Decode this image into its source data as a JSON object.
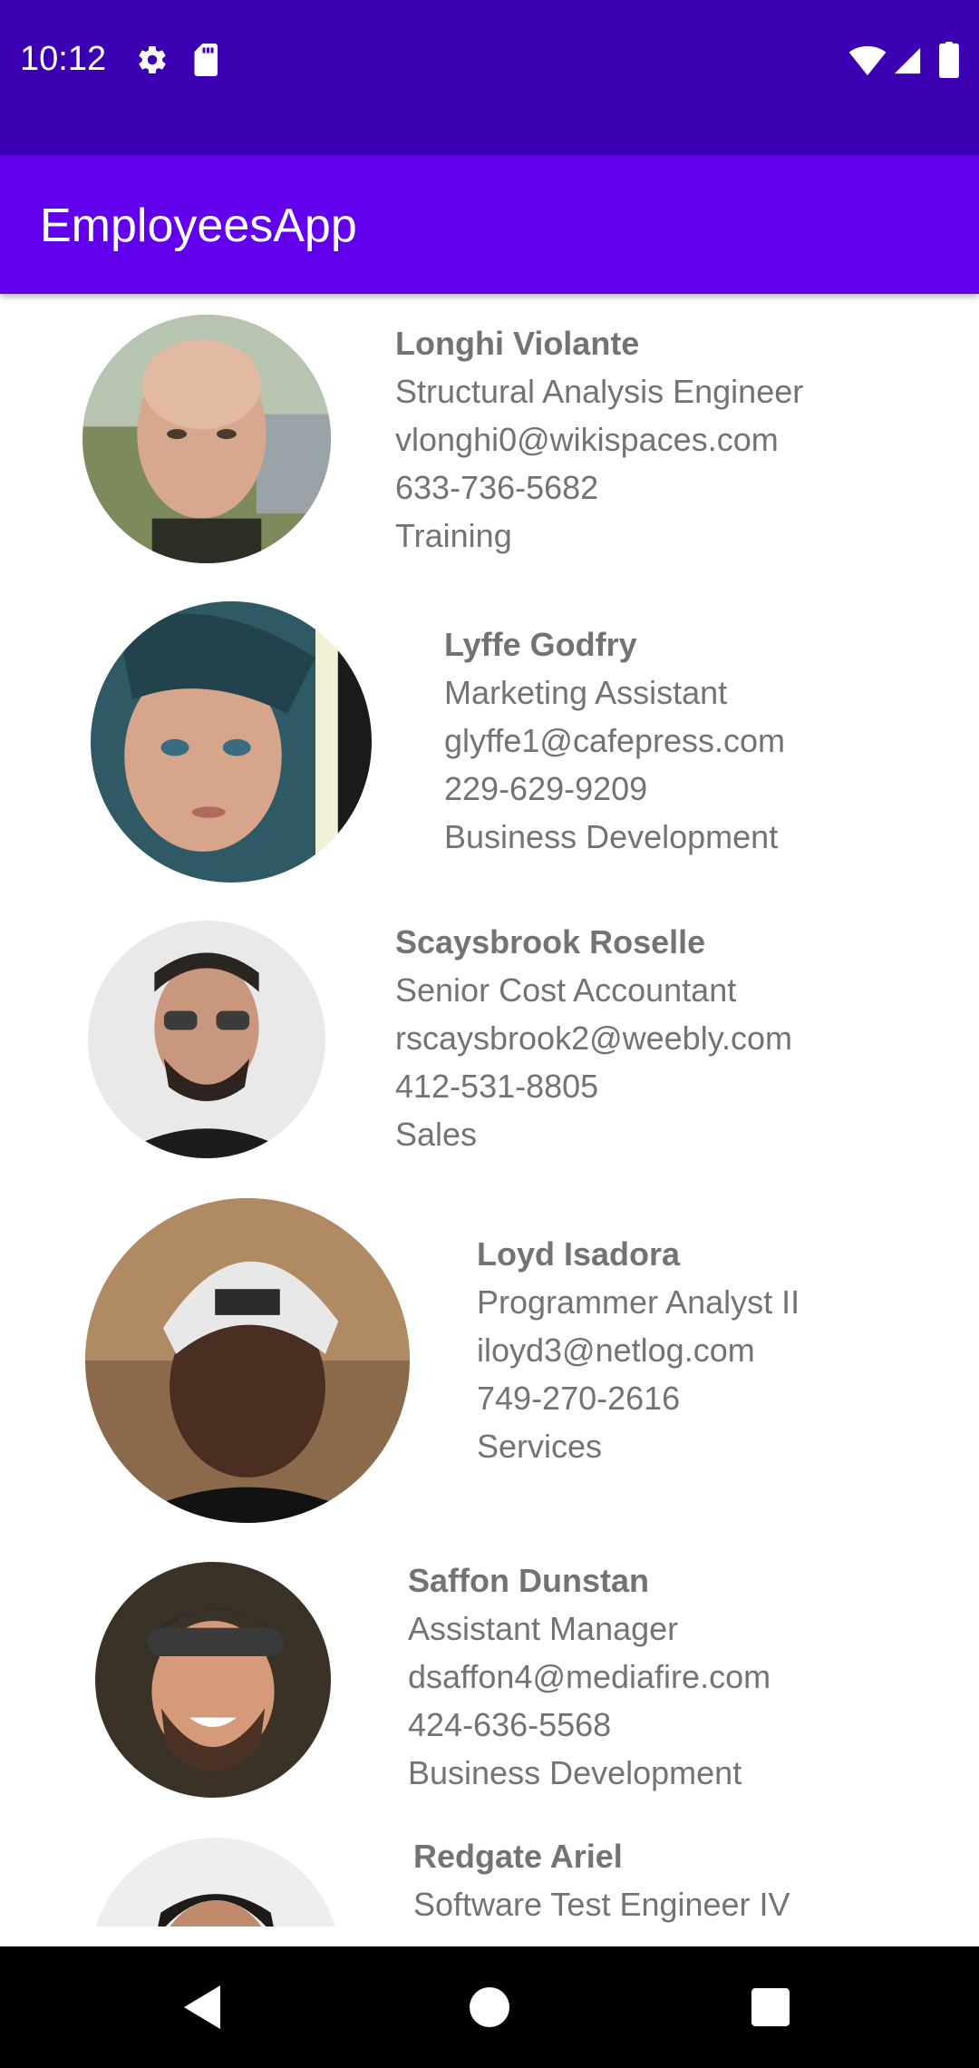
{
  "status_bar": {
    "time": "10:12",
    "left_icons": [
      "gear-icon",
      "sd-card-icon"
    ],
    "right_icons": [
      "wifi-icon",
      "signal-icon",
      "battery-icon"
    ],
    "background": "#3a00b2"
  },
  "app_bar": {
    "title": "EmployeesApp",
    "background": "#6200ee"
  },
  "employees": [
    {
      "name": "Longhi Violante",
      "title": "Structural Analysis Engineer",
      "email": "vlonghi0@wikispaces.com",
      "phone": "633-736-5682",
      "department": "Training"
    },
    {
      "name": "Lyffe Godfry",
      "title": "Marketing Assistant",
      "email": "glyffe1@cafepress.com",
      "phone": "229-629-9209",
      "department": "Business Development"
    },
    {
      "name": "Scaysbrook Roselle",
      "title": "Senior Cost Accountant",
      "email": "rscaysbrook2@weebly.com",
      "phone": "412-531-8805",
      "department": "Sales"
    },
    {
      "name": "Loyd Isadora",
      "title": "Programmer Analyst II",
      "email": "iloyd3@netlog.com",
      "phone": "749-270-2616",
      "department": "Services"
    },
    {
      "name": "Saffon Dunstan",
      "title": "Assistant Manager",
      "email": "dsaffon4@mediafire.com",
      "phone": "424-636-5568",
      "department": "Business Development"
    },
    {
      "name": "Redgate Ariel",
      "title": "Software Test Engineer IV"
    }
  ],
  "nav_bar": {
    "buttons": [
      "back-icon",
      "home-icon",
      "recents-icon"
    ]
  }
}
